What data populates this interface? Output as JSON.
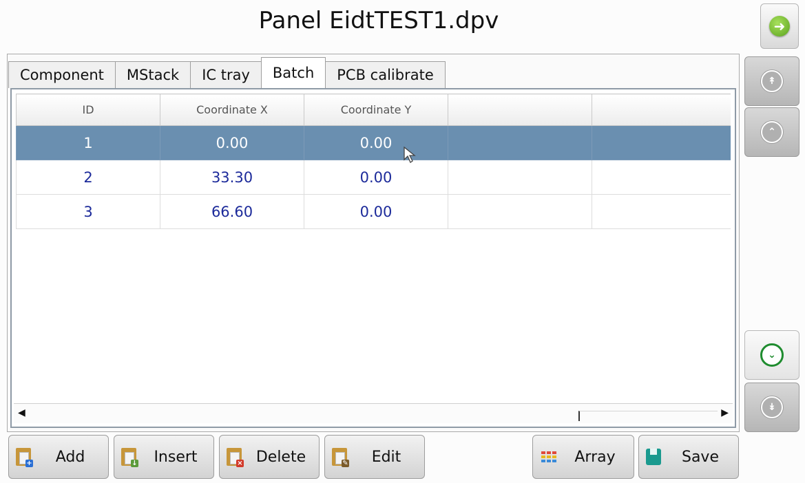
{
  "header": {
    "title": "Panel EidtTEST1.dpv",
    "back_icon": "back-arrow-icon"
  },
  "tabs": [
    {
      "label": "Component",
      "active": false
    },
    {
      "label": "MStack",
      "active": false
    },
    {
      "label": "IC tray",
      "active": false
    },
    {
      "label": "Batch",
      "active": true
    },
    {
      "label": "PCB calibrate",
      "active": false
    }
  ],
  "table": {
    "columns": [
      "ID",
      "Coordinate X",
      "Coordinate Y",
      "",
      ""
    ],
    "rows": [
      {
        "id": "1",
        "x": "0.00",
        "y": "0.00",
        "selected": true
      },
      {
        "id": "2",
        "x": "33.30",
        "y": "0.00",
        "selected": false
      },
      {
        "id": "3",
        "x": "66.60",
        "y": "0.00",
        "selected": false
      }
    ]
  },
  "side_nav": {
    "first_icon": "double-chevron-up-icon",
    "prev_icon": "chevron-up-icon",
    "next_icon": "chevron-down-icon",
    "last_icon": "double-chevron-down-icon"
  },
  "toolbar": {
    "add": "Add",
    "insert": "Insert",
    "delete": "Delete",
    "edit": "Edit",
    "array": "Array",
    "save": "Save"
  },
  "colors": {
    "selected_row": "#6a8fb0",
    "cell_text": "#1c2a9a",
    "accent_green": "#1f8c2f"
  }
}
